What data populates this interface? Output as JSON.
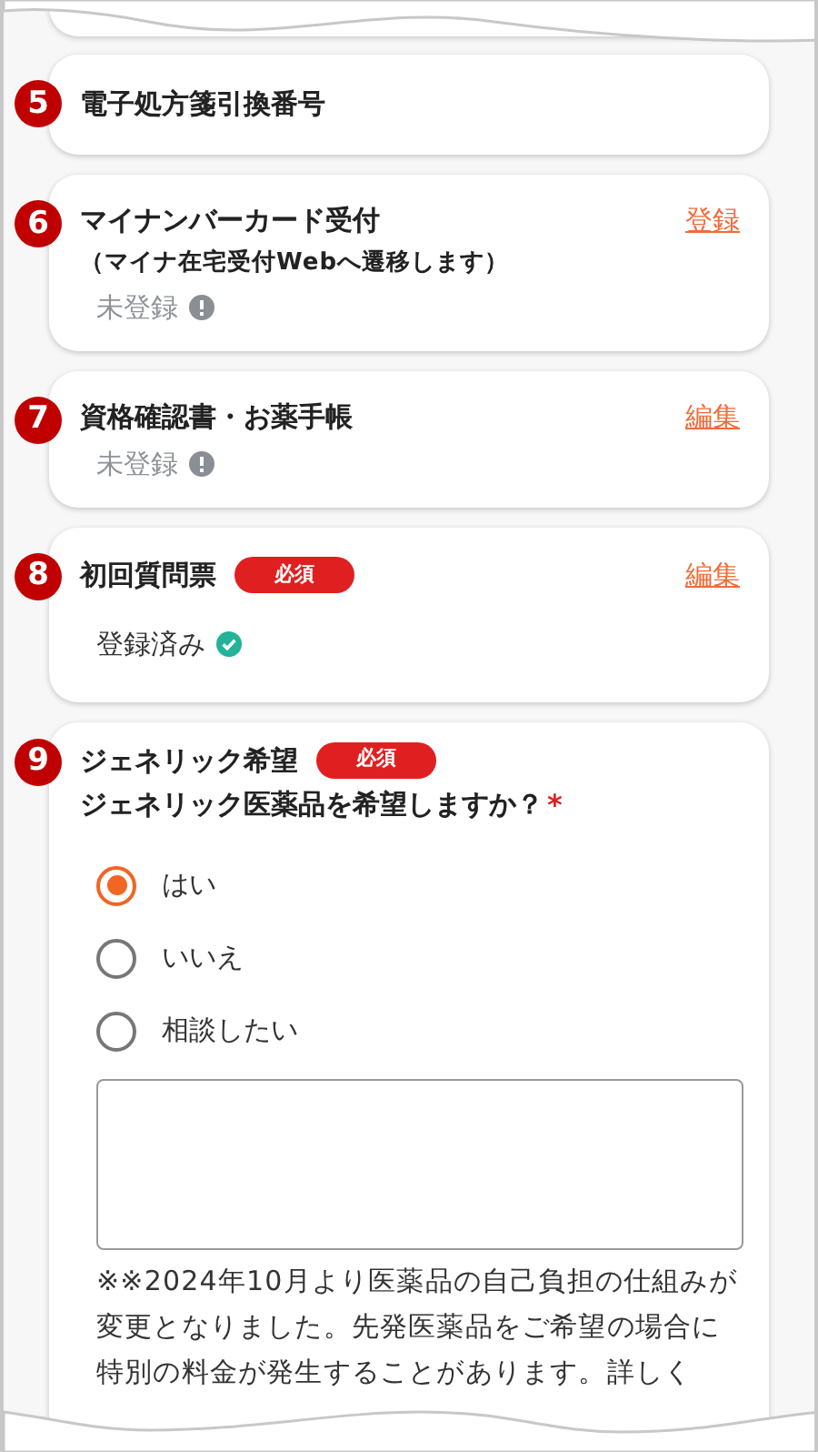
{
  "sections": [
    {
      "number": "5",
      "title": "電子処方箋引換番号"
    },
    {
      "number": "6",
      "title": "マイナンバーカード受付",
      "subtitle": "（マイナ在宅受付Webへ遷移します）",
      "action": "登録",
      "status": {
        "text": "未登録",
        "kind": "unregistered"
      }
    },
    {
      "number": "7",
      "title": "資格確認書・お薬手帳",
      "action": "編集",
      "status": {
        "text": "未登録",
        "kind": "unregistered"
      }
    },
    {
      "number": "8",
      "title": "初回質問票",
      "badge": "必須",
      "action": "編集",
      "status": {
        "text": "登録済み",
        "kind": "registered"
      }
    },
    {
      "number": "9",
      "title": "ジェネリック希望",
      "badge": "必須",
      "question": "ジェネリック医薬品を希望しますか？",
      "required_mark": "*",
      "options": [
        {
          "label": "はい",
          "selected": true
        },
        {
          "label": "いいえ",
          "selected": false
        },
        {
          "label": "相談したい",
          "selected": false
        }
      ],
      "note": "※※2024年10月より医薬品の自己負担の仕組みが変更となりました。先発医薬品をご希望の場合に特別の料金が発生することがあります。詳しく"
    }
  ]
}
